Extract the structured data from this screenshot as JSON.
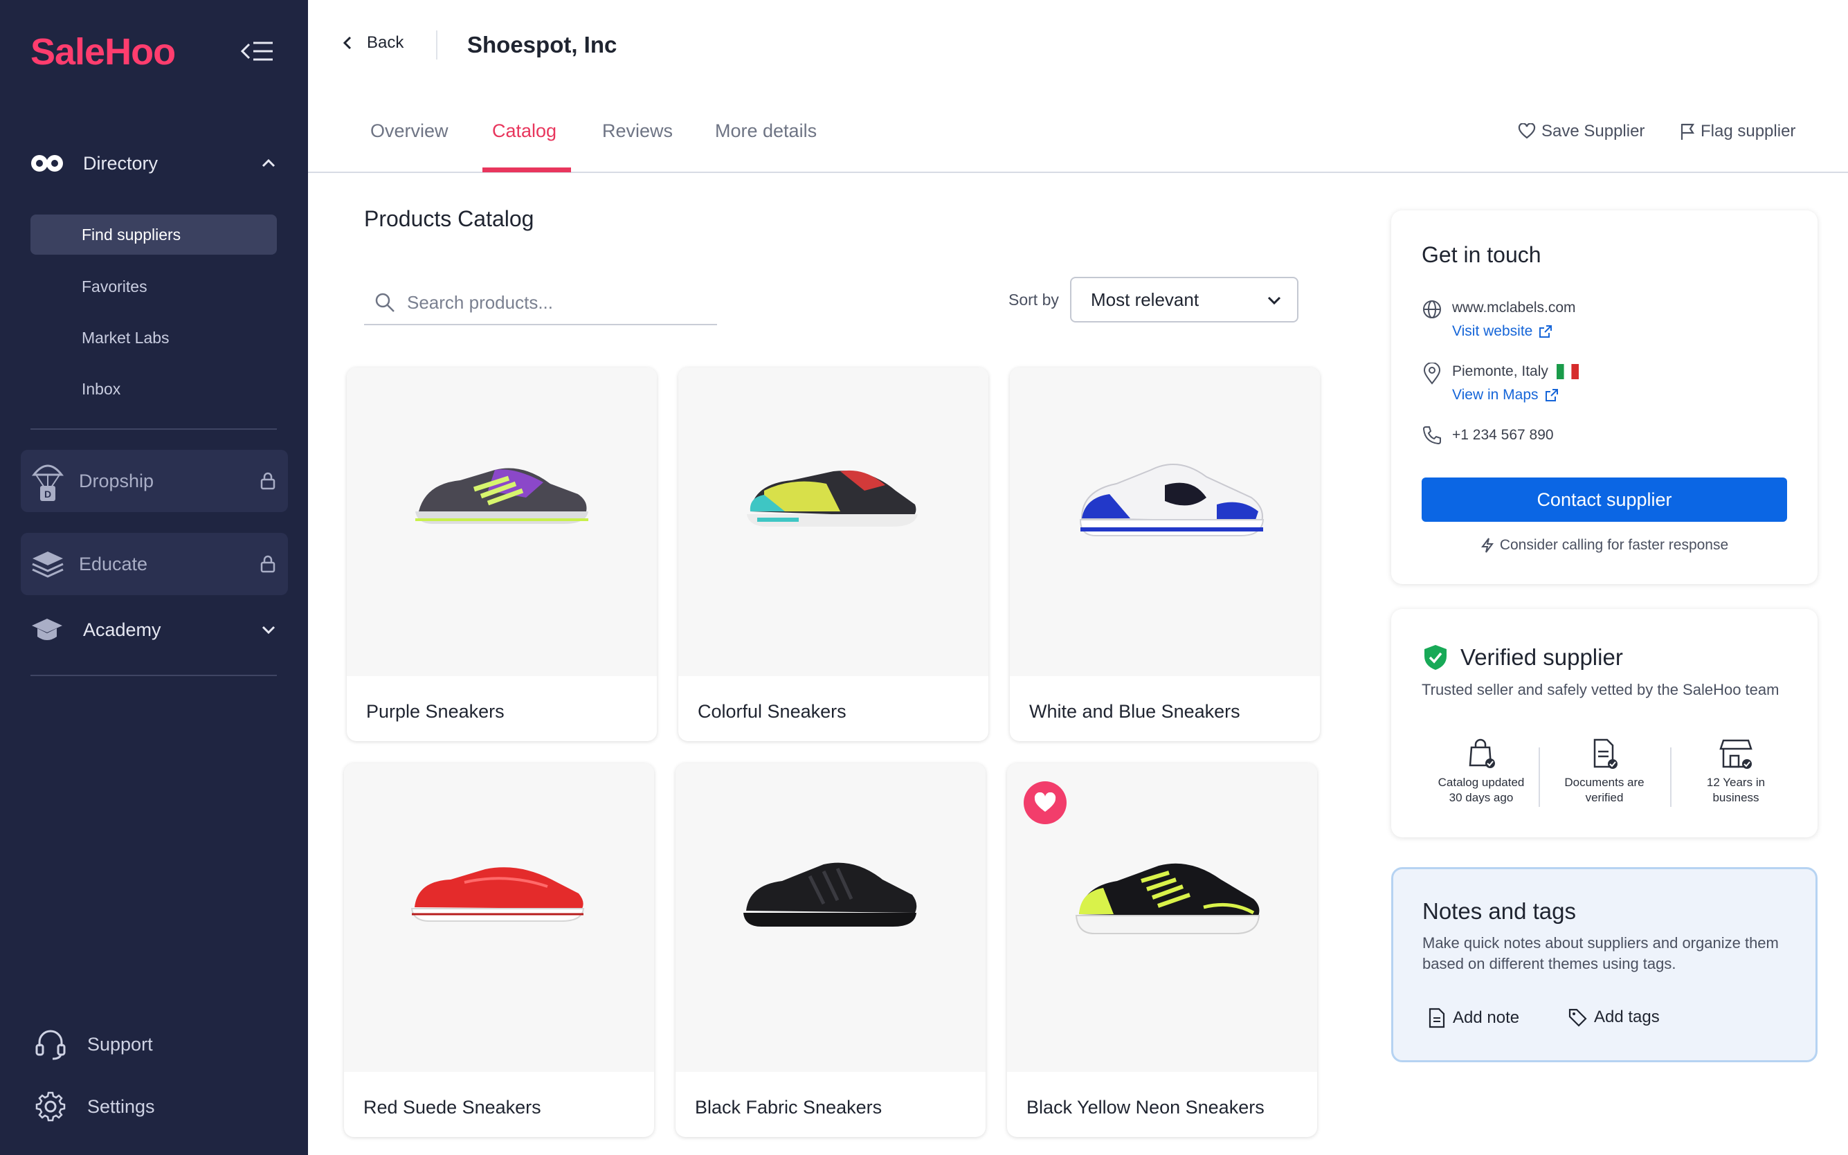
{
  "sidebar": {
    "logo": "SaleHoo",
    "directory": {
      "label": "Directory",
      "items": [
        {
          "label": "Find suppliers",
          "active": true
        },
        {
          "label": "Favorites"
        },
        {
          "label": "Market Labs"
        },
        {
          "label": "Inbox"
        }
      ]
    },
    "dropship": "Dropship",
    "educate": "Educate",
    "academy": "Academy",
    "support": "Support",
    "settings": "Settings"
  },
  "header": {
    "back_label": "Back",
    "supplier_name": "Shoespot, Inc"
  },
  "tabs": [
    {
      "label": "Overview"
    },
    {
      "label": "Catalog",
      "active": true
    },
    {
      "label": "Reviews"
    },
    {
      "label": "More details"
    }
  ],
  "tab_actions": {
    "save": "Save Supplier",
    "flag": "Flag supplier"
  },
  "catalog": {
    "title": "Products Catalog",
    "search_placeholder": "Search products...",
    "sort_label": "Sort by",
    "sort_value": "Most relevant",
    "products": [
      {
        "name": "Purple Sneakers"
      },
      {
        "name": "Colorful Sneakers"
      },
      {
        "name": "White and Blue Sneakers"
      },
      {
        "name": "Red Suede Sneakers"
      },
      {
        "name": "Black Fabric Sneakers"
      },
      {
        "name": "Black Yellow Neon Sneakers",
        "favorite": true
      }
    ]
  },
  "contact": {
    "title": "Get in touch",
    "website": "www.mclabels.com",
    "visit_website": "Visit website",
    "location": "Piemonte, Italy",
    "view_maps": "View in Maps",
    "phone": "+1 234 567 890",
    "button": "Contact supplier",
    "hint": "Consider calling for faster response"
  },
  "verified": {
    "title": "Verified supplier",
    "description": "Trusted seller and safely vetted by the SaleHoo team",
    "badges": [
      {
        "line1": "Catalog updated",
        "line2": "30 days ago"
      },
      {
        "line1": "Documents are",
        "line2": "verified"
      },
      {
        "line1": "12 Years in",
        "line2": "business"
      }
    ]
  },
  "notes": {
    "title": "Notes and tags",
    "description": "Make quick notes about suppliers and organize them based on different themes using tags.",
    "add_note": "Add note",
    "add_tags": "Add tags"
  },
  "colors": {
    "sidebar_bg": "#1f2541",
    "brand": "#ff3d6e",
    "accent_tab": "#e8365d",
    "primary_button": "#0b66e4",
    "verified_green": "#18a957"
  }
}
